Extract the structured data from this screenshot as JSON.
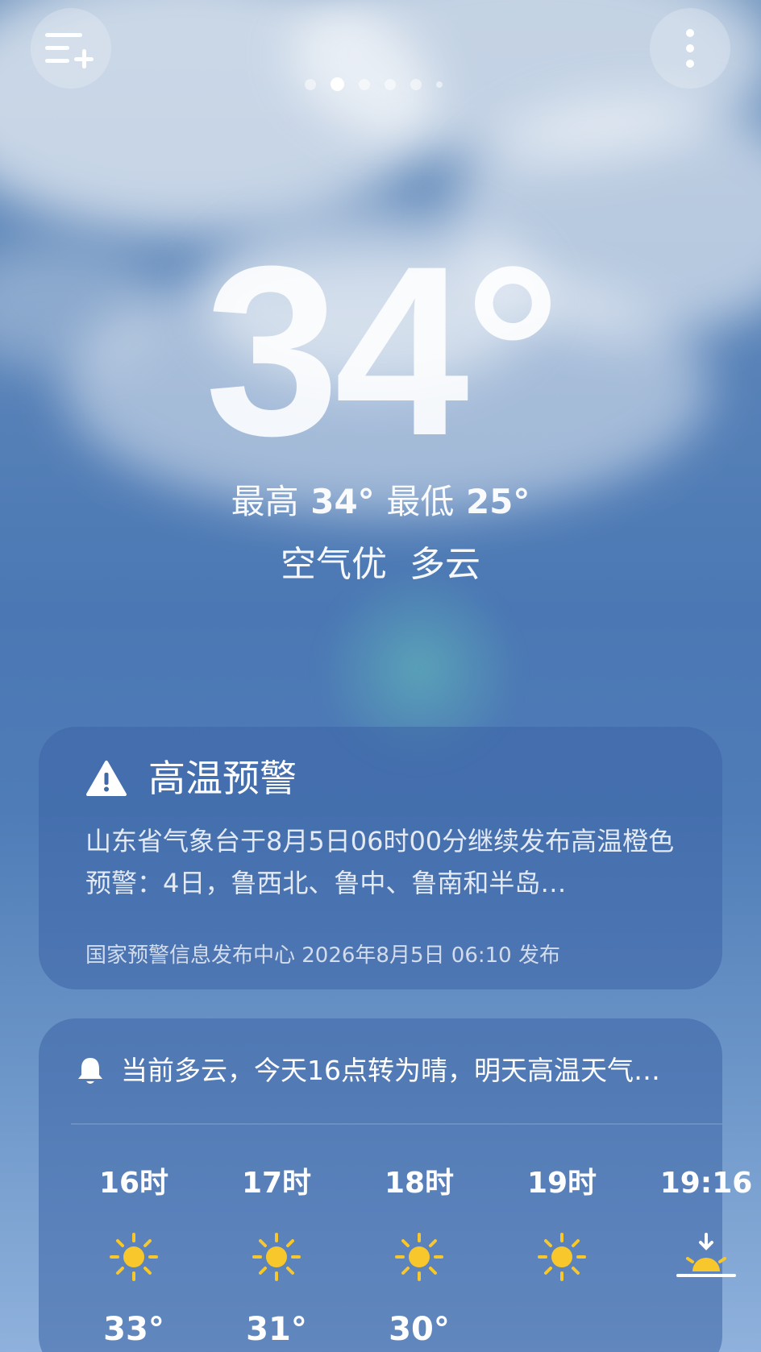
{
  "header": {
    "city": "",
    "page_count": 6,
    "active_page": 1
  },
  "current": {
    "temp": "34°",
    "high_label": "最高",
    "high": "34°",
    "low_label": "最低",
    "low": "25°",
    "air": "空气优",
    "condition": "多云"
  },
  "alert": {
    "icon": "warning-triangle-icon",
    "title": "高温预警",
    "body": "山东省气象台于8月5日06时00分继续发布高温橙色预警：4日，鲁西北、鲁中、鲁南和半岛…",
    "source": "国家预警信息发布中心 2026年8月5日 06:10 发布"
  },
  "forecast": {
    "notice_icon": "bell-icon",
    "notice": "当前多云，今天16点转为晴，明天高温天气…",
    "hours": [
      {
        "time": "16时",
        "icon": "sun-icon",
        "temp": "33°"
      },
      {
        "time": "17时",
        "icon": "sun-icon",
        "temp": "31°"
      },
      {
        "time": "18时",
        "icon": "sun-icon",
        "temp": "30°"
      },
      {
        "time": "19时",
        "icon": "sun-icon",
        "temp": ""
      },
      {
        "time": "19:16",
        "icon": "sunset-icon",
        "temp": ""
      }
    ]
  },
  "colors": {
    "sun": "#f7c72b",
    "card": "#3c64a5"
  }
}
